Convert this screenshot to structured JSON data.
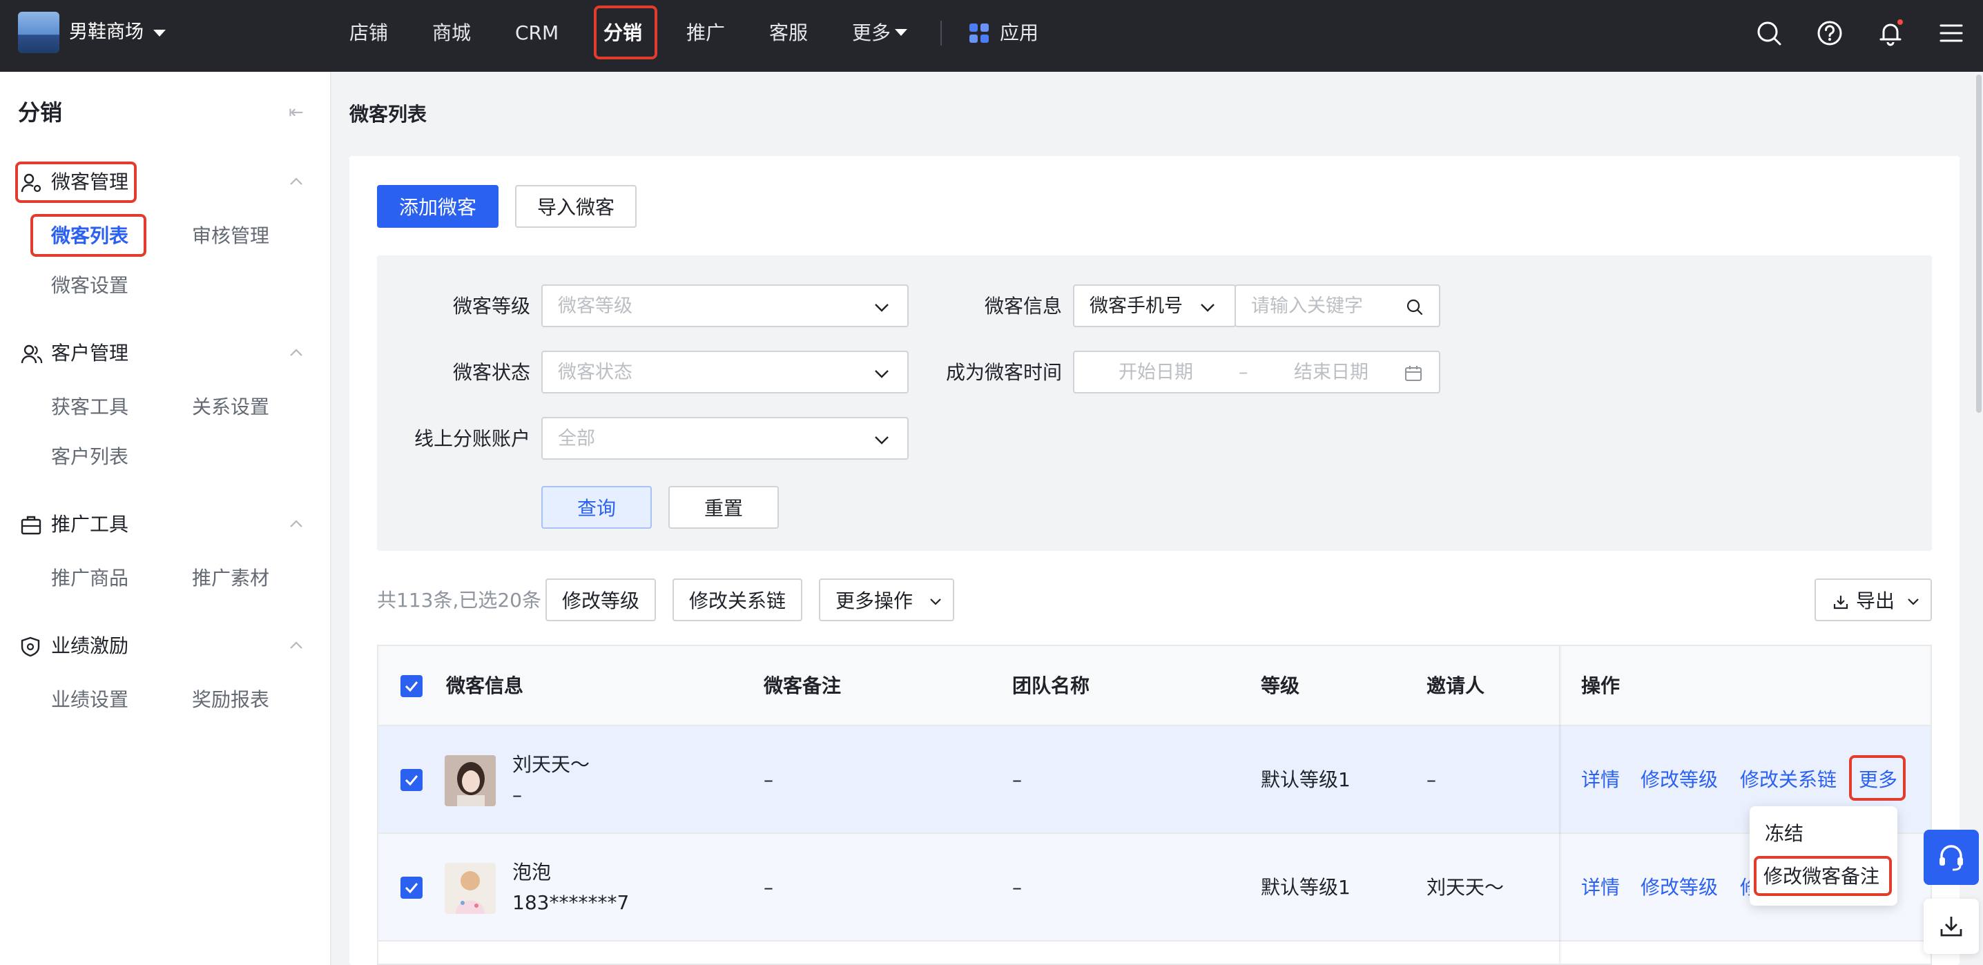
{
  "topbar": {
    "shop_name": "男鞋商场",
    "nav": [
      "店铺",
      "商城",
      "CRM",
      "分销",
      "推广",
      "客服",
      "更多"
    ],
    "apps_label": "应用",
    "colors": {
      "background": "#24262b",
      "accent": "#2b61f0",
      "highlight": "#e23c2d",
      "notification": "#f54a45"
    }
  },
  "sidebar": {
    "title": "分销",
    "groups": [
      {
        "label": "微客管理",
        "icon": "user-settings-icon",
        "items": [
          "微客列表",
          "审核管理",
          "微客设置"
        ]
      },
      {
        "label": "客户管理",
        "icon": "users-icon",
        "items": [
          "获客工具",
          "关系设置",
          "客户列表"
        ]
      },
      {
        "label": "推广工具",
        "icon": "briefcase-icon",
        "items": [
          "推广商品",
          "推广素材"
        ]
      },
      {
        "label": "业绩激励",
        "icon": "badge-icon",
        "items": [
          "业绩设置",
          "奖励报表"
        ]
      }
    ]
  },
  "page": {
    "title": "微客列表",
    "add_button": "添加微客",
    "import_button": "导入微客"
  },
  "filters": {
    "level_label": "微客等级",
    "level_placeholder": "微客等级",
    "info_label": "微客信息",
    "info_type": "微客手机号",
    "keyword_placeholder": "请输入关键字",
    "status_label": "微客状态",
    "status_placeholder": "微客状态",
    "time_label": "成为微客时间",
    "start_placeholder": "开始日期",
    "range_sep": "–",
    "end_placeholder": "结束日期",
    "account_label": "线上分账账户",
    "account_value": "全部",
    "query_button": "查询",
    "reset_button": "重置"
  },
  "toolbar": {
    "summary": "共113条,已选20条",
    "modify_level": "修改等级",
    "modify_chain": "修改关系链",
    "more_ops": "更多操作",
    "export": "导出"
  },
  "table": {
    "columns": [
      "微客信息",
      "微客备注",
      "团队名称",
      "等级",
      "邀请人",
      "操作"
    ],
    "rows": [
      {
        "name": "刘天天～",
        "phone": "–",
        "note": "–",
        "team": "–",
        "level": "默认等级1",
        "inviter": "–",
        "checked": true
      },
      {
        "name": "泡泡",
        "phone": "183*******7",
        "note": "–",
        "team": "–",
        "level": "默认等级1",
        "inviter": "刘天天～",
        "checked": true
      }
    ],
    "actions": {
      "detail": "详情",
      "modify_level": "修改等级",
      "modify_chain": "修改关系链",
      "more": "更多",
      "more_truncated": "修"
    }
  },
  "dropdown": {
    "items": [
      "冻结",
      "修改微客备注"
    ]
  }
}
